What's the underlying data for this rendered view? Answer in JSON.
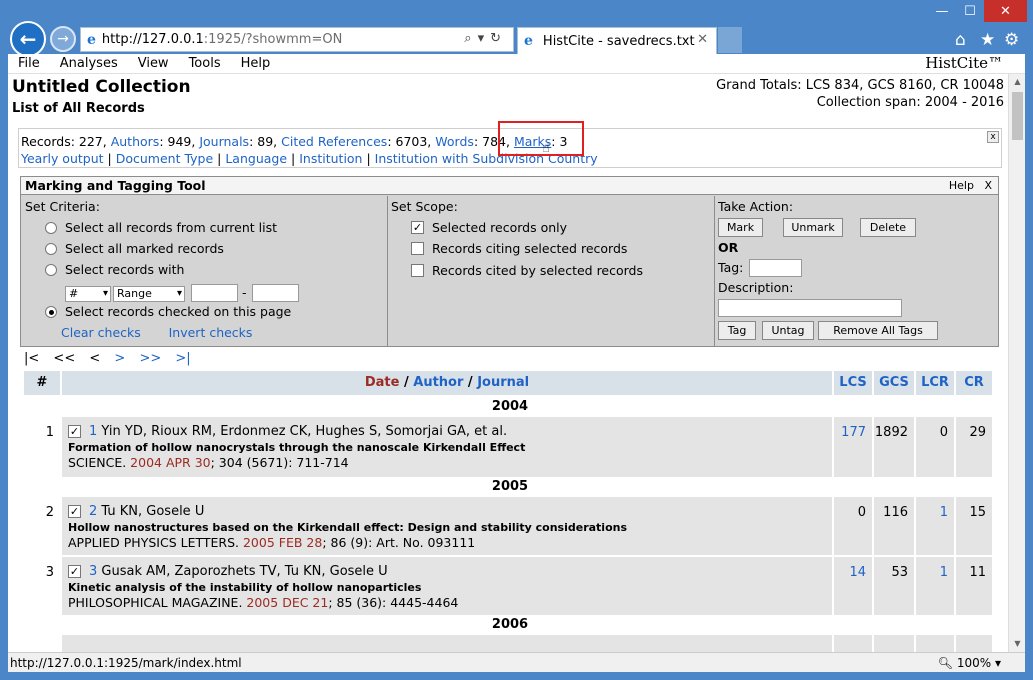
{
  "browser": {
    "url_host": "http://127.0.0.1",
    "url_path": ":1925/?showmm=ON",
    "tab_title": "HistCite - savedrecs.txt",
    "status_url": "http://127.0.0.1:1925/mark/index.html",
    "zoom": "100%"
  },
  "menu": [
    "File",
    "Analyses",
    "View",
    "Tools",
    "Help"
  ],
  "brand": "HistCite™",
  "page": {
    "title": "Untitled Collection",
    "subtitle": "List of All Records",
    "totals_line1": "Grand Totals: LCS 834, GCS 8160, CR 10048",
    "totals_line2": "Collection span: 2004 - 2016"
  },
  "stats": {
    "records_label": "Records: 227,",
    "authors_link": "Authors",
    "authors_val": ": 949,",
    "journals_link": "Journals",
    "journals_val": ": 89,",
    "cited_link": "Cited References",
    "cited_val": ": 6703,",
    "words_link": "Words",
    "words_val": ": 784,",
    "marks_link": "Marks",
    "marks_val": ": 3",
    "links2": [
      "Yearly output",
      "Document Type",
      "Language",
      "Institution",
      "Institution with Subdivision",
      "Country"
    ],
    "close": "x"
  },
  "marking": {
    "title": "Marking and Tagging Tool",
    "help": "Help",
    "close": "X",
    "criteria_label": "Set Criteria:",
    "crit1": "Select all records from current list",
    "crit2": "Select all marked records",
    "crit3": "Select records with",
    "sel1": "#",
    "sel2": "Range",
    "dash": "-",
    "crit4": "Select records checked on this page",
    "clear_checks": "Clear checks",
    "invert_checks": "Invert checks",
    "scope_label": "Set Scope:",
    "scope1": "Selected records only",
    "scope2": "Records citing selected records",
    "scope3": "Records cited by selected records",
    "action_label": "Take Action:",
    "mark_btn": "Mark",
    "unmark_btn": "Unmark",
    "delete_btn": "Delete",
    "or": "OR",
    "tag_label": "Tag:",
    "desc_label": "Description:",
    "tag_btn": "Tag",
    "untag_btn": "Untag",
    "remove_btn": "Remove All Tags"
  },
  "pager": {
    "first": "|<",
    "prev2": "<<",
    "prev": "<",
    "next": ">",
    "next2": ">>",
    "last": ">|"
  },
  "table": {
    "h_num": "#",
    "h_date": "Date",
    "h_sep1": " / ",
    "h_author": "Author",
    "h_sep2": " / ",
    "h_journal": "Journal",
    "h_lcs": "LCS",
    "h_gcs": "GCS",
    "h_lcr": "LCR",
    "h_cr": "CR",
    "year2004": "2004",
    "year2005": "2005",
    "year2006": "2006",
    "records": [
      {
        "n": "1",
        "id": "1",
        "authors": "Yin YD, Rioux RM, Erdonmez CK, Hughes S, Somorjai GA, et al.",
        "title": "Formation of hollow nanocrystals through the nanoscale Kirkendall Effect",
        "journal": "SCIENCE. ",
        "date": "2004 APR 30",
        "rest": "; 304 (5671): 711-714",
        "lcs": "177",
        "gcs": "1892",
        "lcr": "0",
        "cr": "29"
      },
      {
        "n": "2",
        "id": "2",
        "authors": "Tu KN, Gosele U",
        "title": "Hollow nanostructures based on the Kirkendall effect: Design and stability considerations",
        "journal": "APPLIED PHYSICS LETTERS. ",
        "date": "2005 FEB 28",
        "rest": "; 86 (9): Art. No. 093111",
        "lcs": "0",
        "gcs": "116",
        "lcr": "1",
        "cr": "15"
      },
      {
        "n": "3",
        "id": "3",
        "authors": "Gusak AM, Zaporozhets TV, Tu KN, Gosele U",
        "title": "Kinetic analysis of the instability of hollow nanoparticles",
        "journal": "PHILOSOPHICAL MAGAZINE. ",
        "date": "2005 DEC 21",
        "rest": "; 85 (36): 4445-4464",
        "lcs": "14",
        "gcs": "53",
        "lcr": "1",
        "cr": "11"
      }
    ]
  },
  "colors": {
    "link": "#1f63c6",
    "date": "#9c2b22",
    "highlight": "#e02020"
  }
}
